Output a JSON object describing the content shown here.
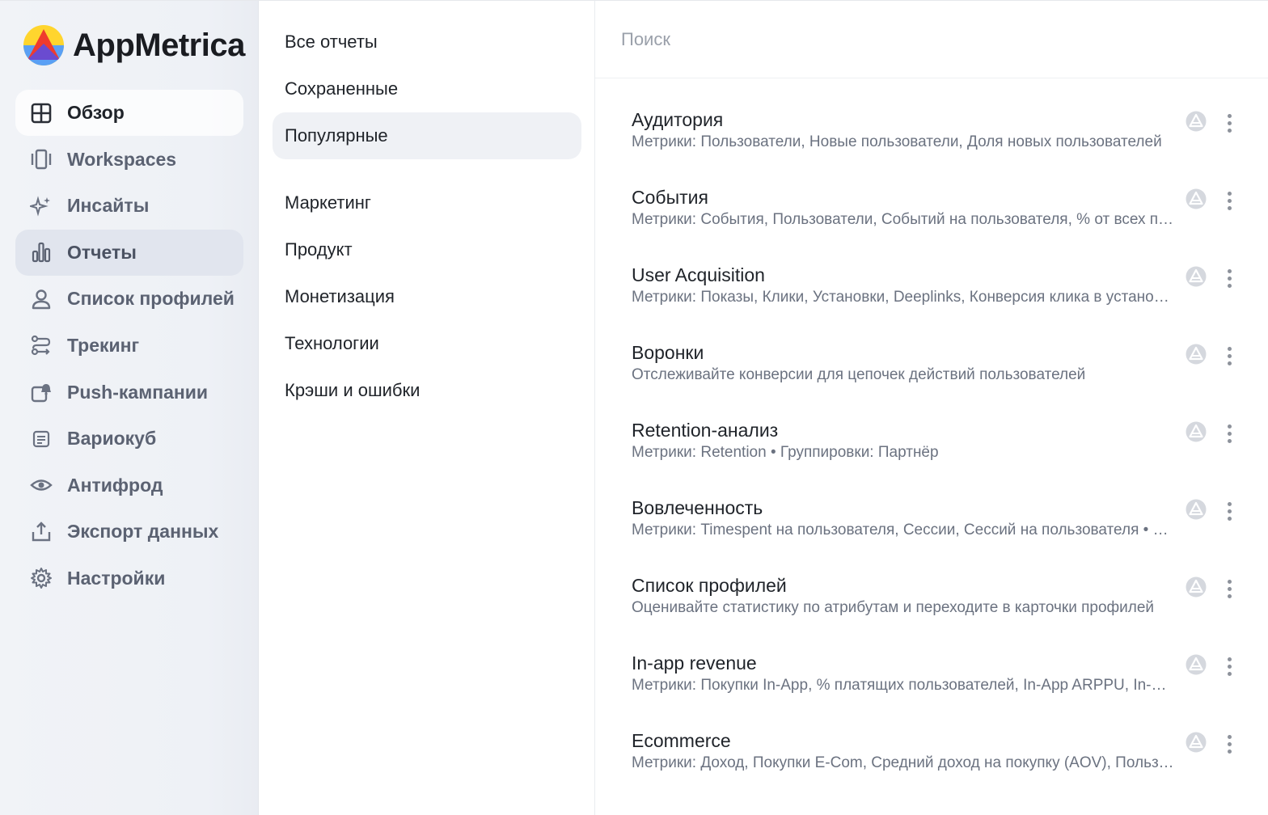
{
  "brand": {
    "name": "AppMetrica"
  },
  "sidebar": {
    "items": [
      {
        "label": "Обзор",
        "icon": "grid-icon"
      },
      {
        "label": "Workspaces",
        "icon": "workspaces-icon"
      },
      {
        "label": "Инсайты",
        "icon": "sparkle-icon"
      },
      {
        "label": "Отчеты",
        "icon": "bar-chart-icon"
      },
      {
        "label": "Список профилей",
        "icon": "user-icon"
      },
      {
        "label": "Трекинг",
        "icon": "route-icon"
      },
      {
        "label": "Push-кампании",
        "icon": "push-bell-icon"
      },
      {
        "label": "Вариокуб",
        "icon": "cube-icon"
      },
      {
        "label": "Антифрод",
        "icon": "eye-icon"
      },
      {
        "label": "Экспорт данных",
        "icon": "export-icon"
      },
      {
        "label": "Настройки",
        "icon": "gear-icon"
      }
    ]
  },
  "categories": {
    "top": [
      "Все отчеты",
      "Сохраненные",
      "Популярные"
    ],
    "groups": [
      "Маркетинг",
      "Продукт",
      "Монетизация",
      "Технологии",
      "Крэши и ошибки"
    ]
  },
  "search": {
    "placeholder": "Поиск",
    "value": ""
  },
  "reports": [
    {
      "title": "Аудитория",
      "desc": "Метрики: Пользователи, Новые пользователи, Доля новых пользователей"
    },
    {
      "title": "События",
      "desc": "Метрики: События, Пользователи, Событий на пользователя, % от всех пользователей"
    },
    {
      "title": "User Acquisition",
      "desc": "Метрики: Показы, Клики, Установки, Deeplinks, Конверсия клика в установку"
    },
    {
      "title": "Воронки",
      "desc": "Отслеживайте конверсии для цепочек действий пользователей"
    },
    {
      "title": "Retention-анализ",
      "desc": "Метрики: Retention • Группировки: Партнёр"
    },
    {
      "title": "Вовлеченность",
      "desc": "Метрики: Timespent на пользователя, Сессии, Сессий на пользователя • Группировки"
    },
    {
      "title": "Список профилей",
      "desc": "Оценивайте статистику по атрибутам и переходите в карточки профилей"
    },
    {
      "title": "In-app revenue",
      "desc": "Метрики: Покупки In-App, % платящих пользователей, In-App ARPPU, In-App ARPU"
    },
    {
      "title": "Ecommerce",
      "desc": "Метрики: Доход, Покупки E-Com, Средний доход на покупку (AOV), Пользователи"
    }
  ],
  "colors": {
    "accent_active_bg": "#e1e5ee",
    "sidebar_bg": "#f1f3f7",
    "muted_text": "#6b7280"
  }
}
